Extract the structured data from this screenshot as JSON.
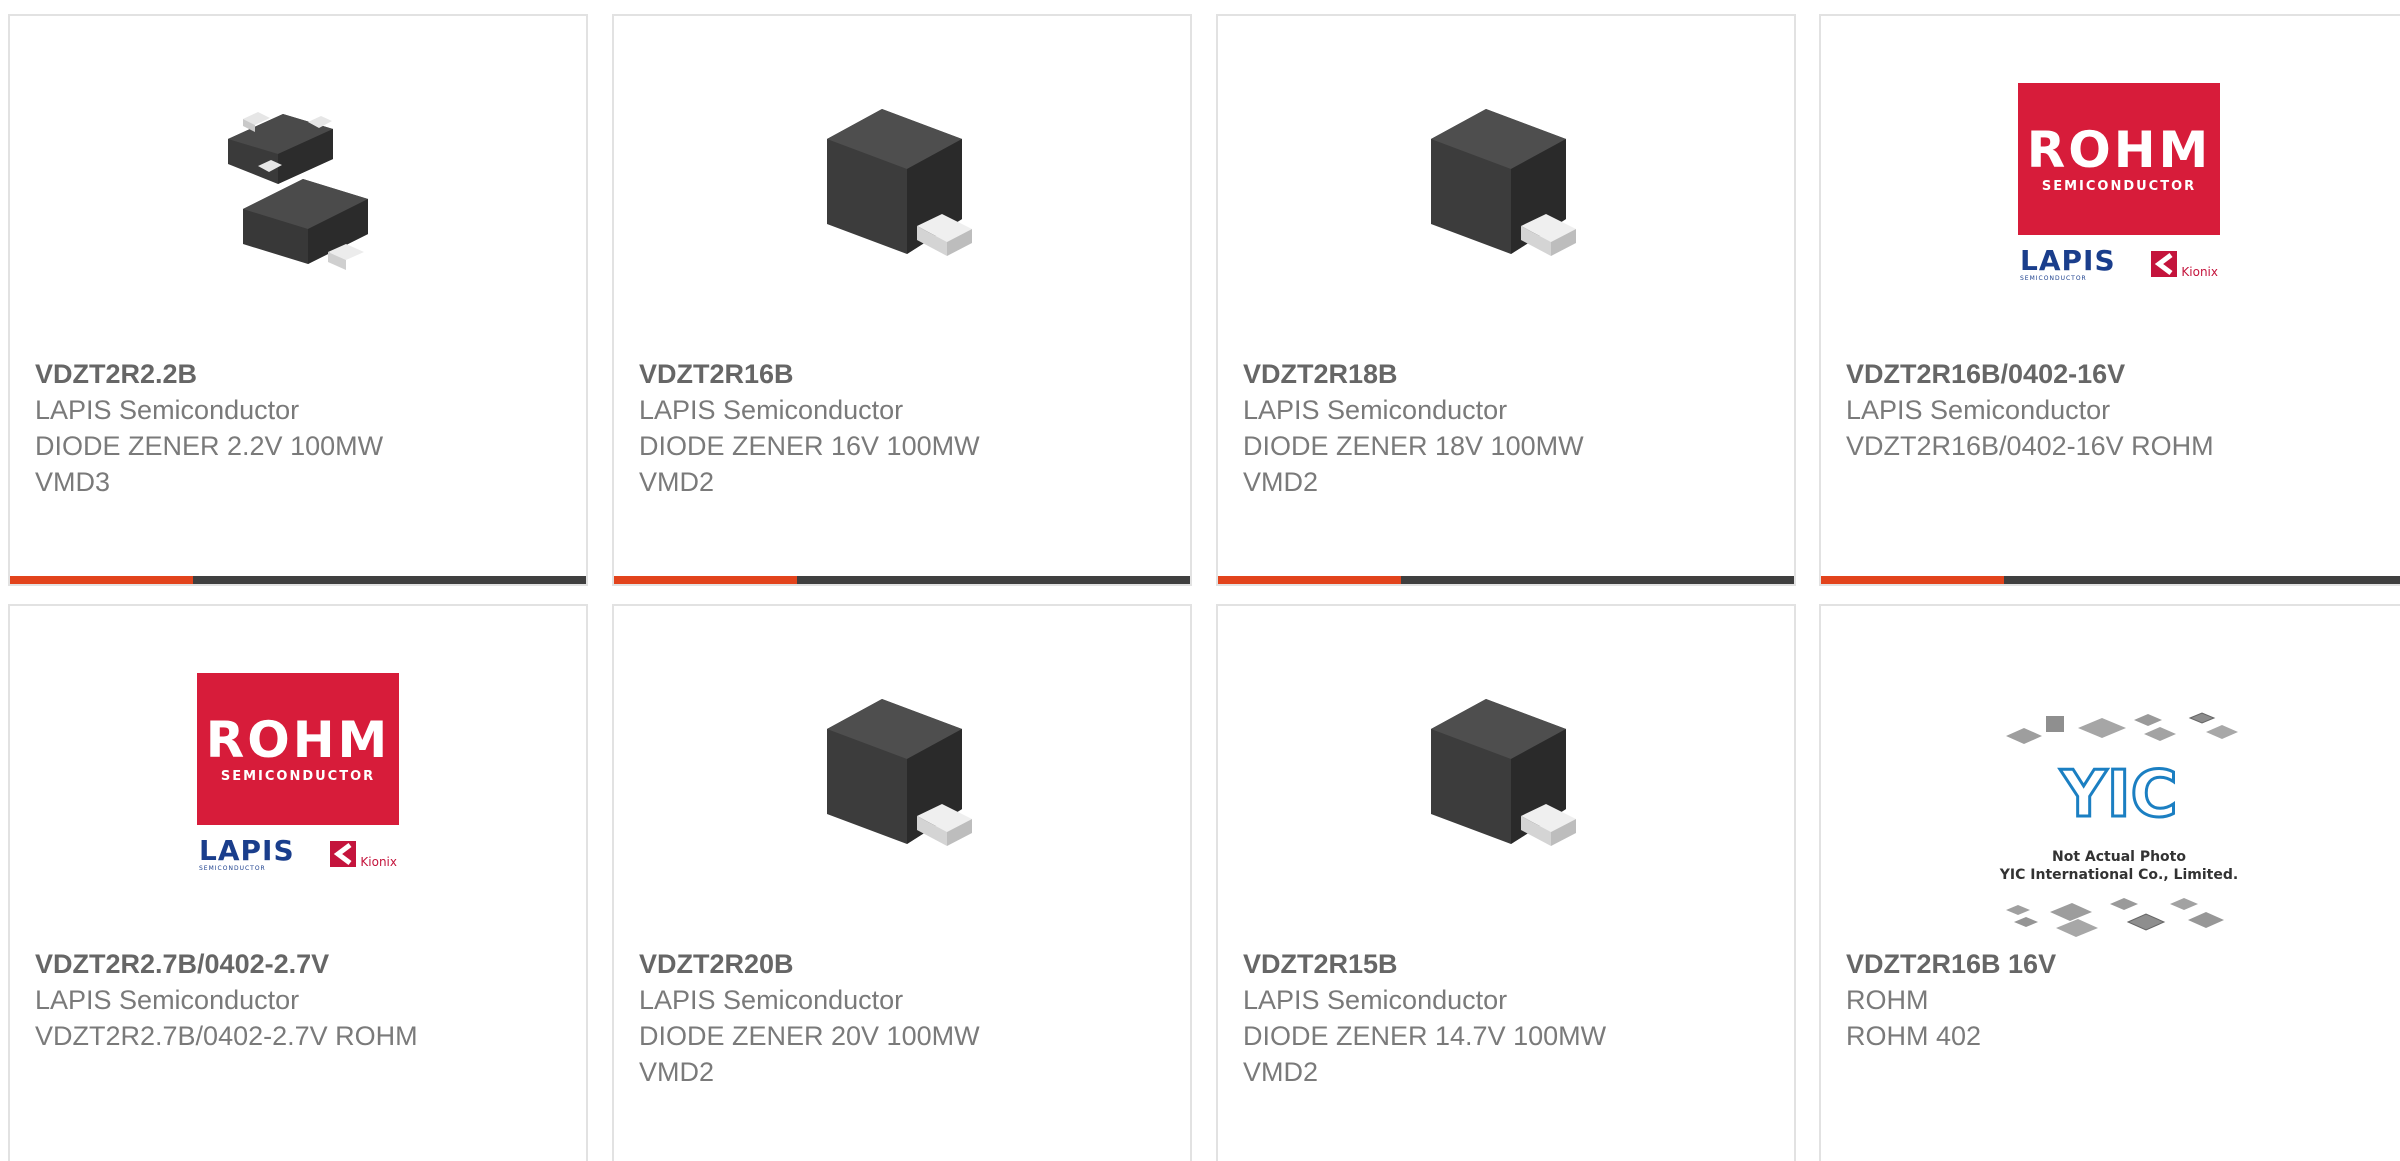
{
  "colors": {
    "accent": "#e2431c",
    "bar": "#3f3f3f",
    "card_border": "#e2e2e2",
    "rohm_red": "#d71c3a",
    "lapis_blue": "#1a3e8c"
  },
  "products": [
    {
      "part_number": "VDZT2R2.2B",
      "manufacturer": "LAPIS Semiconductor",
      "description": "DIODE ZENER 2.2V 100MW",
      "package": "VMD3",
      "image": "sot-package-icon"
    },
    {
      "part_number": "VDZT2R16B",
      "manufacturer": "LAPIS Semiconductor",
      "description": "DIODE ZENER 16V 100MW",
      "package": "VMD2",
      "image": "diode-package-icon"
    },
    {
      "part_number": "VDZT2R18B",
      "manufacturer": "LAPIS Semiconductor",
      "description": "DIODE ZENER 18V 100MW",
      "package": "VMD2",
      "image": "diode-package-icon"
    },
    {
      "part_number": "VDZT2R16B/0402-16V",
      "manufacturer": "LAPIS Semiconductor",
      "description": "VDZT2R16B/0402-16V ROHM",
      "package": "",
      "image": "rohm-logo"
    },
    {
      "part_number": "VDZT2R2.7B/0402-2.7V",
      "manufacturer": "LAPIS Semiconductor",
      "description": "VDZT2R2.7B/0402-2.7V ROHM",
      "package": "",
      "image": "rohm-logo"
    },
    {
      "part_number": "VDZT2R20B",
      "manufacturer": "LAPIS Semiconductor",
      "description": "DIODE ZENER 20V 100MW",
      "package": "VMD2",
      "image": "diode-package-icon"
    },
    {
      "part_number": "VDZT2R15B",
      "manufacturer": "LAPIS Semiconductor",
      "description": "DIODE ZENER 14.7V 100MW",
      "package": "VMD2",
      "image": "diode-package-icon"
    },
    {
      "part_number": "VDZT2R16B 16V",
      "manufacturer": "ROHM",
      "description": "ROHM 402",
      "package": "",
      "image": "yic-placeholder"
    }
  ],
  "logos": {
    "rohm_word": "ROHM",
    "rohm_sub": "SEMICONDUCTOR",
    "lapis_word": "LAPIS",
    "lapis_sub": "SEMICONDUCTOR",
    "kionix_word": "Kionix",
    "yic_mark": "YIC",
    "yic_line1": "Not Actual Photo",
    "yic_line2": "YIC International Co., Limited."
  }
}
